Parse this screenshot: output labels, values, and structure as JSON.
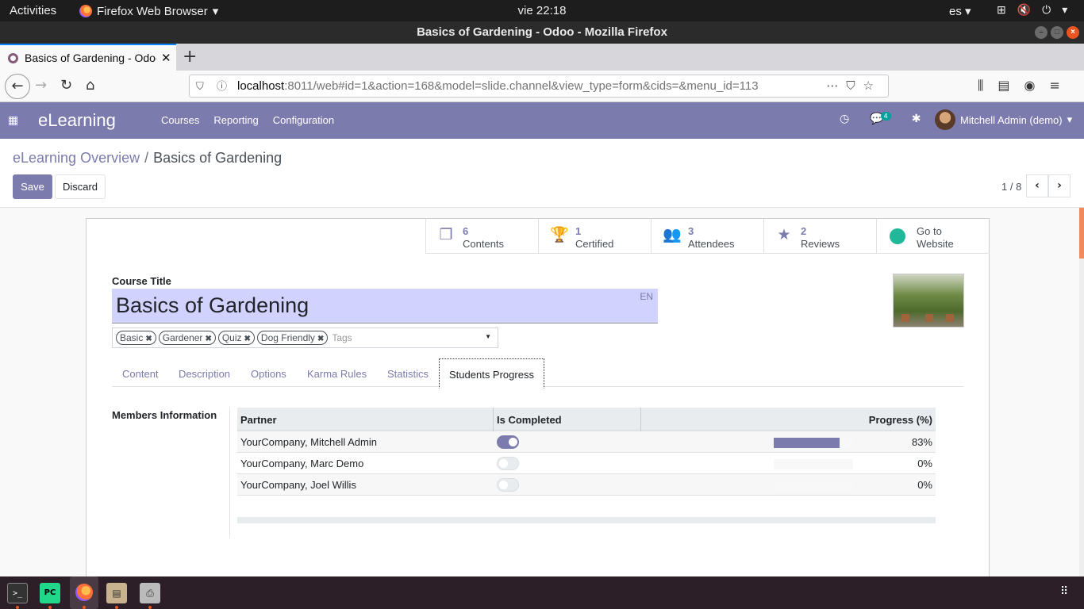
{
  "system": {
    "activities": "Activities",
    "app_name": "Firefox Web Browser",
    "clock": "vie 22:18",
    "lang": "es"
  },
  "browser": {
    "window_title": "Basics of Gardening - Odoo - Mozilla Firefox",
    "tab_title": "Basics of Gardening - Odoo",
    "url_host": "localhost",
    "url_rest": ":8011/web#id=1&action=168&model=slide.channel&view_type=form&cids=&menu_id=113"
  },
  "odoo": {
    "app_title": "eLearning",
    "menu": [
      "Courses",
      "Reporting",
      "Configuration"
    ],
    "chat_badge": "4",
    "user_name": "Mitchell Admin (demo)",
    "breadcrumb": {
      "parent": "eLearning Overview",
      "separator": "/",
      "current": "Basics of Gardening"
    },
    "save_label": "Save",
    "discard_label": "Discard",
    "pager": "1 / 8",
    "colors": {
      "primary": "#7c7bad",
      "accent": "#00a09d"
    }
  },
  "stats": [
    {
      "num": "6",
      "label": "Contents",
      "icon": "copy-icon"
    },
    {
      "num": "1",
      "label": "Certified",
      "icon": "trophy-icon"
    },
    {
      "num": "3",
      "label": "Attendees",
      "icon": "users-icon"
    },
    {
      "num": "2",
      "label": "Reviews",
      "icon": "star-icon"
    },
    {
      "line1": "Go to",
      "line2": "Website",
      "icon": "globe-icon"
    }
  ],
  "form": {
    "title_label": "Course Title",
    "title_value": "Basics of Gardening",
    "lang_badge": "EN",
    "tags": [
      "Basic",
      "Gardener",
      "Quiz",
      "Dog Friendly"
    ],
    "tags_placeholder": "Tags",
    "tabs": [
      "Content",
      "Description",
      "Options",
      "Karma Rules",
      "Statistics",
      "Students Progress"
    ],
    "active_tab": "Students Progress",
    "members_label": "Members Information"
  },
  "table": {
    "headers": [
      "Partner",
      "Is Completed",
      "Progress (%)"
    ],
    "rows": [
      {
        "partner": "YourCompany, Mitchell Admin",
        "completed": true,
        "progress": 83,
        "progress_label": "83%"
      },
      {
        "partner": "YourCompany, Marc Demo",
        "completed": false,
        "progress": 0,
        "progress_label": "0%"
      },
      {
        "partner": "YourCompany, Joel Willis",
        "completed": false,
        "progress": 0,
        "progress_label": "0%"
      }
    ]
  }
}
